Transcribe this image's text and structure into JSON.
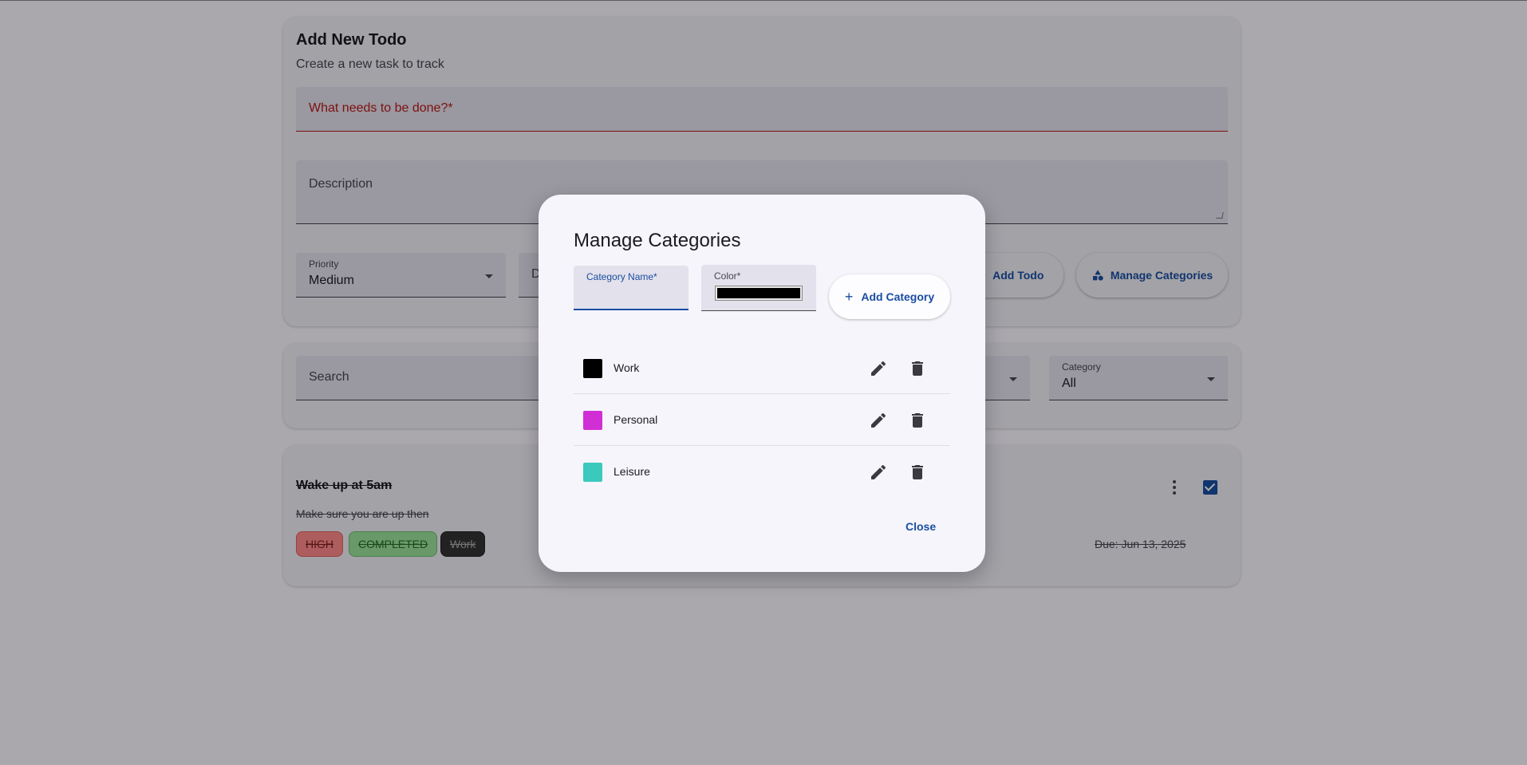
{
  "add_todo": {
    "title": "Add New Todo",
    "subtitle": "Create a new task to track",
    "title_field_label": "What needs to be done?*",
    "description_label": "Description",
    "priority_label": "Priority",
    "priority_value": "Medium",
    "due_label": "D",
    "add_todo_button": "Add Todo",
    "manage_categories_button": "Manage Categories"
  },
  "filters": {
    "search_label": "Search",
    "category_label": "Category",
    "category_value": "All"
  },
  "todo": {
    "title": "Wake up at 5am",
    "description": "Make sure you are up then",
    "chips": [
      "HIGH",
      "COMPLETED",
      "Work"
    ],
    "due": "Due: Jun 13, 2025",
    "completed": true
  },
  "dialog": {
    "title": "Manage Categories",
    "name_label": "Category Name*",
    "name_value": "",
    "color_label": "Color*",
    "color_value": "#000000",
    "add_button": "Add Category",
    "close_button": "Close",
    "categories": [
      {
        "name": "Work",
        "color": "#000000"
      },
      {
        "name": "Personal",
        "color": "#d12fd6"
      },
      {
        "name": "Leisure",
        "color": "#3cc9bd"
      }
    ]
  },
  "colors": {
    "primary": "#1a4ea2",
    "error": "#ba1a1a"
  }
}
